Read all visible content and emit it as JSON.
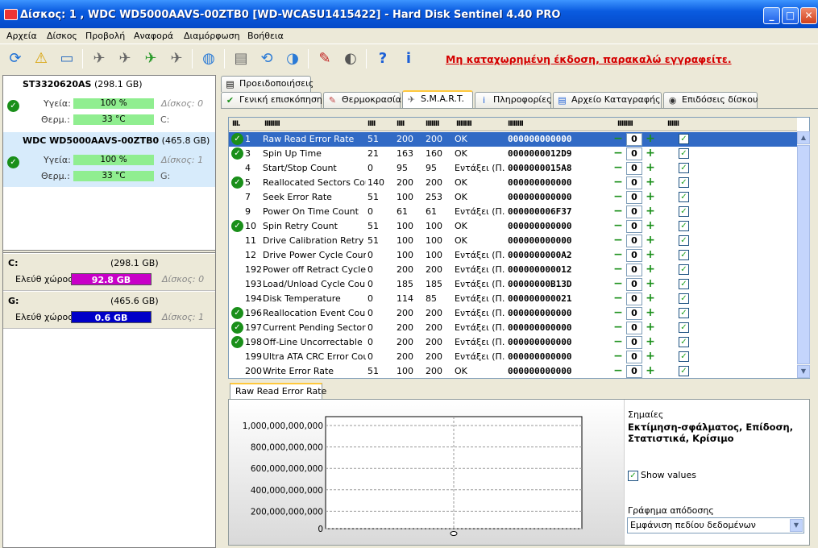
{
  "window": {
    "title": "Δίσκος: 1 , WDC WD5000AAVS-00ZTB0 [WD-WCASU1415422]  -  Hard Disk Sentinel 4.40 PRO"
  },
  "menu": [
    "Αρχεία",
    "Δίσκος",
    "Προβολή",
    "Αναφορά",
    "Διαμόρφωση",
    "Βοήθεια"
  ],
  "toolbar": {
    "registration_text": "Μη καταχωρημένη έκδοση, παρακαλώ εγγραφείτε."
  },
  "disks": [
    {
      "model": "ST3320620AS",
      "size": "(298.1 GB)",
      "health_label": "Υγεία:",
      "health": "100 %",
      "temp_label": "Θερμ.:",
      "temp": "33 °C",
      "disk_no": "Δίσκος: 0",
      "drive": "C:"
    },
    {
      "model": "WDC WD5000AAVS-00ZTB0",
      "size": "(465.8 GB)",
      "health_label": "Υγεία:",
      "health": "100 %",
      "temp_label": "Θερμ.:",
      "temp": "33 °C",
      "disk_no": "Δίσκος: 1",
      "drive": "G:"
    }
  ],
  "partitions": [
    {
      "letter": "C:",
      "size": "(298.1 GB)",
      "free_label": "Ελεύθ χώρος",
      "free": "92.8 GB",
      "disk_no": "Δίσκος: 0",
      "color": "#c800c8"
    },
    {
      "letter": "G:",
      "size": "(465.6 GB)",
      "free_label": "Ελεύθ χώρος",
      "free": "0.6 GB",
      "disk_no": "Δίσκος: 1",
      "color": "#0000c8"
    }
  ],
  "tabs_top": [
    "Προειδοποιήσεις"
  ],
  "tabs": [
    "Γενική επισκόπηση",
    "Θερμοκρασία",
    "S.M.A.R.T.",
    "Πληροφορίες",
    "Αρχείο Καταγραφής",
    "Επιδόσεις δίσκου"
  ],
  "grid": {
    "headers": [
      "ΙΙΙ.",
      "ΙΙΙΙΙΙΙΙ",
      "ΙΙΙΙ",
      "ΙΙΙΙ",
      "ΙΙΙΙΙΙΙ",
      "ΙΙΙΙΙΙΙΙ",
      "ΙΙΙΙΙΙΙΙ",
      "ΙΙΙΙΙΙΙΙ",
      "ΙΙΙΙΙΙ"
    ],
    "rows": [
      {
        "ok": true,
        "id": "1",
        "name": "Raw Read Error Rate",
        "threshold": "51",
        "value": "200",
        "worst": "200",
        "status": "OK",
        "data": "000000000000",
        "offset": "0"
      },
      {
        "ok": true,
        "id": "3",
        "name": "Spin Up Time",
        "threshold": "21",
        "value": "163",
        "worst": "160",
        "status": "OK",
        "data": "0000000012D9",
        "offset": "0"
      },
      {
        "ok": false,
        "id": "4",
        "name": "Start/Stop Count",
        "threshold": "0",
        "value": "95",
        "worst": "95",
        "status": "Εντάξει (Π...",
        "data": "0000000015A8",
        "offset": "0"
      },
      {
        "ok": true,
        "id": "5",
        "name": "Reallocated Sectors Count",
        "threshold": "140",
        "value": "200",
        "worst": "200",
        "status": "OK",
        "data": "000000000000",
        "offset": "0"
      },
      {
        "ok": false,
        "id": "7",
        "name": "Seek Error Rate",
        "threshold": "51",
        "value": "100",
        "worst": "253",
        "status": "OK",
        "data": "000000000000",
        "offset": "0"
      },
      {
        "ok": false,
        "id": "9",
        "name": "Power On Time Count",
        "threshold": "0",
        "value": "61",
        "worst": "61",
        "status": "Εντάξει (Π...",
        "data": "000000006F37",
        "offset": "0"
      },
      {
        "ok": true,
        "id": "10",
        "name": "Spin Retry Count",
        "threshold": "51",
        "value": "100",
        "worst": "100",
        "status": "OK",
        "data": "000000000000",
        "offset": "0"
      },
      {
        "ok": false,
        "id": "11",
        "name": "Drive Calibration Retry Co...",
        "threshold": "51",
        "value": "100",
        "worst": "100",
        "status": "OK",
        "data": "000000000000",
        "offset": "0"
      },
      {
        "ok": false,
        "id": "12",
        "name": "Drive Power Cycle Count",
        "threshold": "0",
        "value": "100",
        "worst": "100",
        "status": "Εντάξει (Π...",
        "data": "0000000000A2",
        "offset": "0"
      },
      {
        "ok": false,
        "id": "192",
        "name": "Power off Retract Cycle ...",
        "threshold": "0",
        "value": "200",
        "worst": "200",
        "status": "Εντάξει (Π...",
        "data": "000000000012",
        "offset": "0"
      },
      {
        "ok": false,
        "id": "193",
        "name": "Load/Unload Cycle Count",
        "threshold": "0",
        "value": "185",
        "worst": "185",
        "status": "Εντάξει (Π...",
        "data": "00000000B13D",
        "offset": "0"
      },
      {
        "ok": false,
        "id": "194",
        "name": "Disk Temperature",
        "threshold": "0",
        "value": "114",
        "worst": "85",
        "status": "Εντάξει (Π...",
        "data": "000000000021",
        "offset": "0"
      },
      {
        "ok": true,
        "id": "196",
        "name": "Reallocation Event Count",
        "threshold": "0",
        "value": "200",
        "worst": "200",
        "status": "Εντάξει (Π...",
        "data": "000000000000",
        "offset": "0"
      },
      {
        "ok": true,
        "id": "197",
        "name": "Current Pending Sector C...",
        "threshold": "0",
        "value": "200",
        "worst": "200",
        "status": "Εντάξει (Π...",
        "data": "000000000000",
        "offset": "0"
      },
      {
        "ok": true,
        "id": "198",
        "name": "Off-Line Uncorrectable S...",
        "threshold": "0",
        "value": "200",
        "worst": "200",
        "status": "Εντάξει (Π...",
        "data": "000000000000",
        "offset": "0"
      },
      {
        "ok": false,
        "id": "199",
        "name": "Ultra ATA CRC Error Count",
        "threshold": "0",
        "value": "200",
        "worst": "200",
        "status": "Εντάξει (Π...",
        "data": "000000000000",
        "offset": "0"
      },
      {
        "ok": false,
        "id": "200",
        "name": "Write Error Rate",
        "threshold": "51",
        "value": "100",
        "worst": "200",
        "status": "OK",
        "data": "000000000000",
        "offset": "0"
      }
    ]
  },
  "bottom": {
    "tab": "Raw Read Error Rate",
    "y_ticks": [
      "1,000,000,000,000",
      "800,000,000,000",
      "600,000,000,000",
      "400,000,000,000",
      "200,000,000,000",
      "0"
    ],
    "point_label": "0",
    "notes_label": "Σημαίες",
    "notes_values": "Εκτίμηση-σφάλματος, Επίδοση, Στατιστικά, Κρίσιμο",
    "show_values": "Show values",
    "chart_mode_label": "Γράφημα απόδοσης",
    "chart_mode": "Εμφάνιση πεδίου δεδομένων"
  },
  "chart_data": {
    "type": "line",
    "title": "Raw Read Error Rate",
    "ylim": [
      0,
      1000000000000
    ],
    "series": [
      {
        "values": [
          0
        ]
      }
    ]
  }
}
